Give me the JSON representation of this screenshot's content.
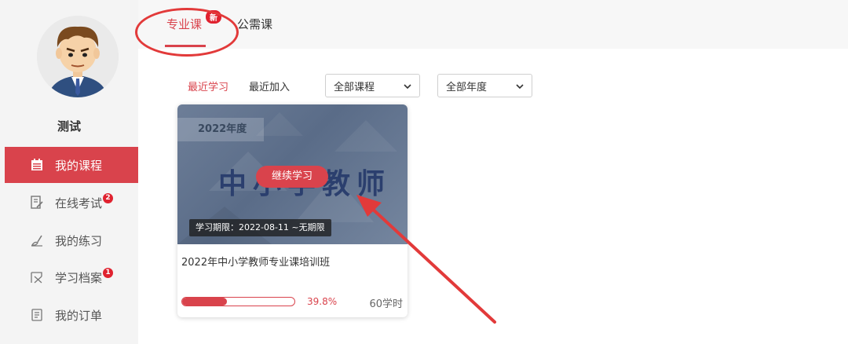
{
  "user": {
    "name": "测试"
  },
  "sidebar": {
    "items": [
      {
        "label": "我的课程",
        "icon": "calendar-icon",
        "badge": ""
      },
      {
        "label": "在线考试",
        "icon": "exam-icon",
        "badge": "2"
      },
      {
        "label": "我的练习",
        "icon": "brush-icon",
        "badge": ""
      },
      {
        "label": "学习档案",
        "icon": "archive-icon",
        "badge": "1"
      },
      {
        "label": "我的订单",
        "icon": "order-icon",
        "badge": ""
      }
    ]
  },
  "tabs": {
    "professional": "专业课",
    "new_badge": "新",
    "public": "公需课"
  },
  "filters": {
    "recent_study": "最近学习",
    "recent_added": "最近加入",
    "course_select": "全部课程",
    "year_select": "全部年度"
  },
  "course": {
    "banner_year": "2022年度",
    "banner_title": "中小学教师",
    "continue_label": "继续学习",
    "period": "学习期限：2022-08-11 ~无期限",
    "name": "2022年中小学教师专业课培训班",
    "progress": 0.398,
    "progress_text": "39.8%",
    "hours": "60学时"
  },
  "colors": {
    "accent": "#d9434c",
    "annotation": "#e23a3a"
  }
}
